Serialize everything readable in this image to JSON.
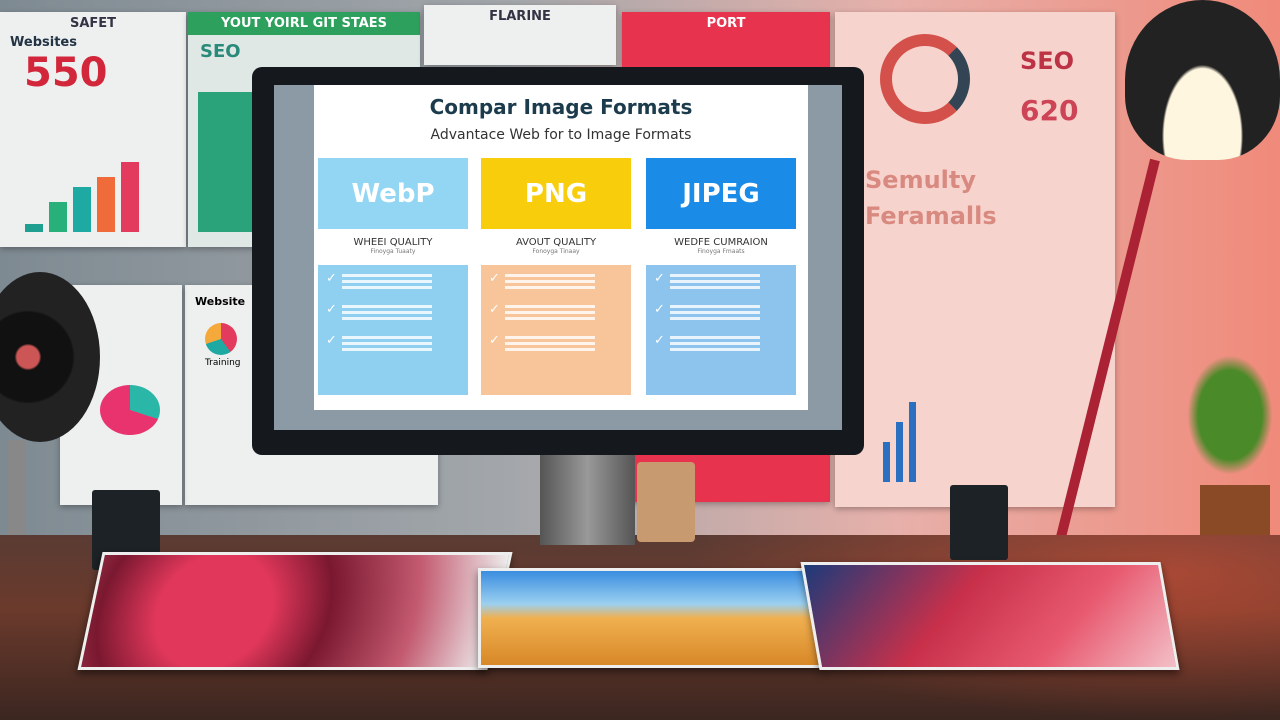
{
  "posters": [
    {
      "title": "SAFET",
      "label": "Websites",
      "number": "550"
    },
    {
      "title": "YOUT YOIRL GIT STAES",
      "label": "SEO"
    },
    {
      "title": "FLARINE"
    },
    {
      "title": "PORT"
    },
    {
      "title": "SEO",
      "number": "620",
      "label": "Semulty Feramalls"
    },
    {
      "label": "Website"
    },
    {
      "label": "Training"
    }
  ],
  "slide": {
    "title": "Compar Image Formats",
    "subtitle": "Advantace Web for to Image Formats",
    "columns": [
      {
        "name": "WebP",
        "quality": "WHEEI QUALITY",
        "sub": "Finoyga Tuaaty",
        "color": "#93d6f4",
        "list_color": "#8fcff0"
      },
      {
        "name": "PNG",
        "quality": "AVOUT QUALITY",
        "sub": "Fonoyga Tinaay",
        "color": "#f7cd0c",
        "list_color": "#f8c59a"
      },
      {
        "name": "JIPEG",
        "quality": "WEDFE CUMRAION",
        "sub": "Finoyga Fmaats",
        "color": "#1a8be6",
        "list_color": "#8cc4ee"
      }
    ],
    "check_icon": "check-icon"
  }
}
